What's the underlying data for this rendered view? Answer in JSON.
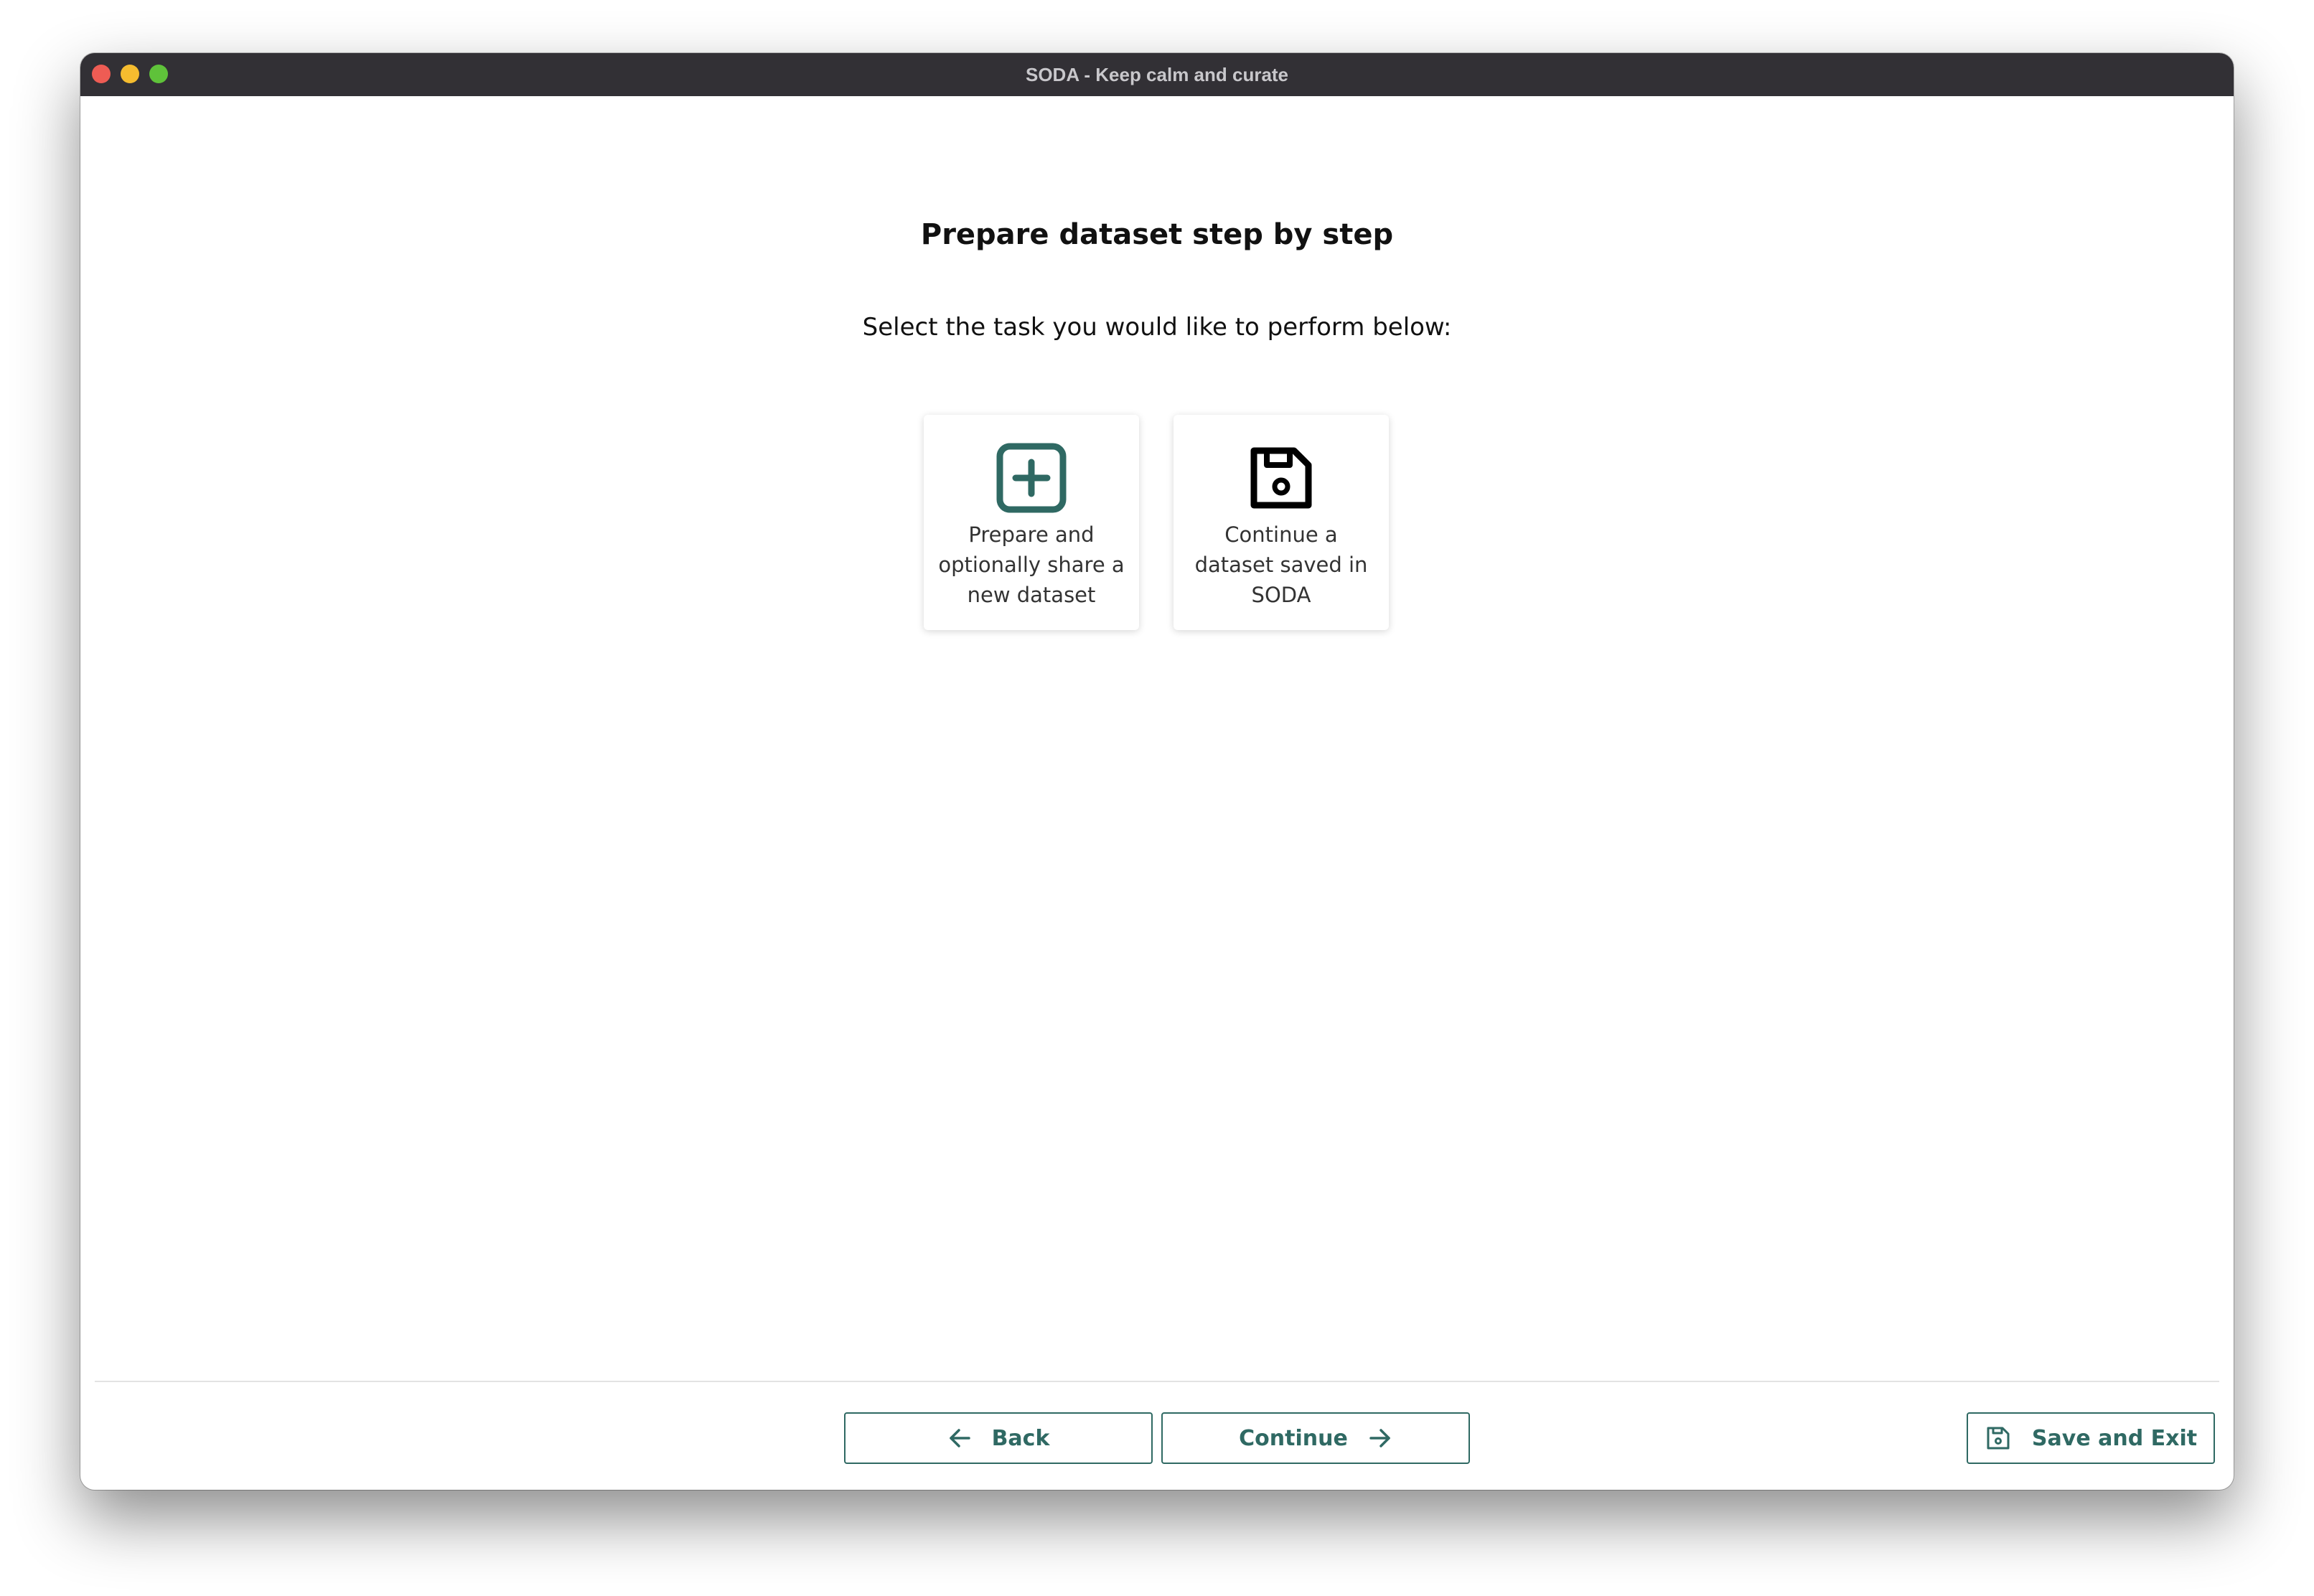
{
  "window": {
    "title": "SODA - Keep calm and curate"
  },
  "main": {
    "title": "Prepare dataset step by step",
    "subtitle": "Select the task you would like to perform below:",
    "cards": [
      {
        "label": "Prepare and optionally share a new dataset",
        "icon": "plus-square-icon"
      },
      {
        "label": "Continue a dataset saved in SODA",
        "icon": "floppy-disk-icon"
      }
    ]
  },
  "footer": {
    "back_label": "Back",
    "continue_label": "Continue",
    "save_exit_label": "Save and Exit"
  },
  "colors": {
    "accent": "#2f6963",
    "titlebar": "#323035",
    "traffic_close": "#ee5c54",
    "traffic_min": "#f5bc2f",
    "traffic_max": "#5fc23a"
  }
}
